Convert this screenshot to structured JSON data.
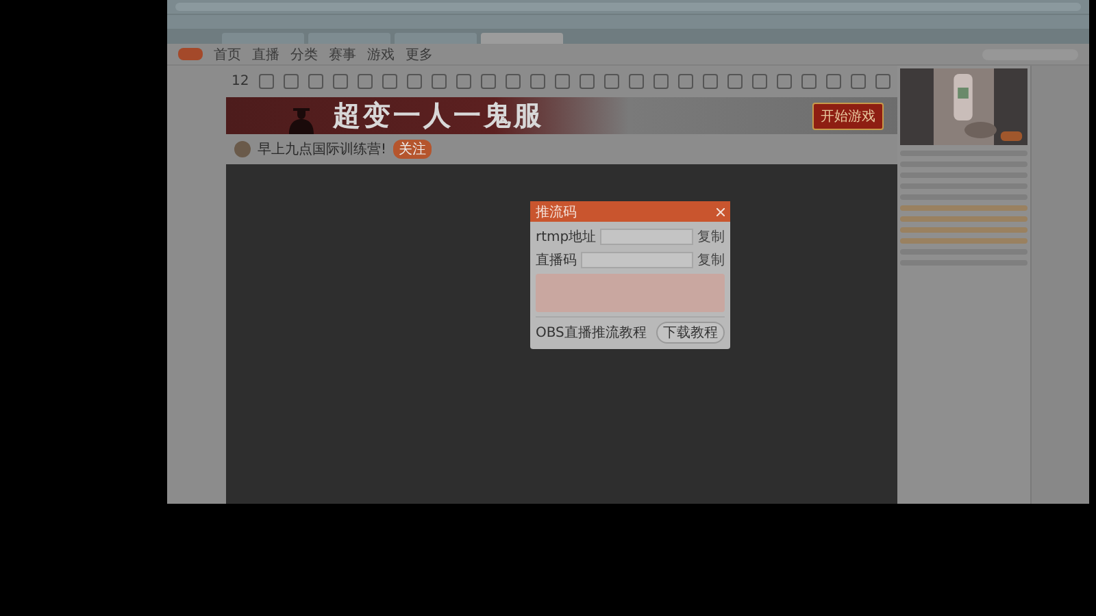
{
  "browser_tabs": [
    {
      "selected": false
    },
    {
      "selected": false
    },
    {
      "selected": false
    },
    {
      "selected": true
    }
  ],
  "site_header": {
    "nav": [
      "首页",
      "直播",
      "分类",
      "赛事",
      "游戏",
      "更多"
    ]
  },
  "level": "12",
  "banner": {
    "title": "超变一人一鬼服",
    "cta": "开始游戏"
  },
  "room": {
    "title": "早上九点国际训练营!",
    "follow": "关注"
  },
  "modal": {
    "title": "推流码",
    "fields": [
      {
        "label": "rtmp地址",
        "action": "复制"
      },
      {
        "label": "直播码",
        "action": "复制"
      }
    ],
    "tutorial": {
      "title": "OBS直播推流教程",
      "button": "下载教程"
    }
  }
}
